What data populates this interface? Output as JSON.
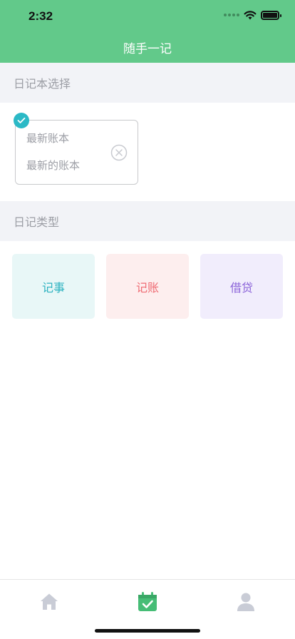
{
  "status": {
    "time": "2:32"
  },
  "nav": {
    "title": "随手一记"
  },
  "notebook_section": {
    "title": "日记本选择",
    "selected_notebook": {
      "name": "最新账本",
      "description": "最新的账本"
    }
  },
  "type_section": {
    "title": "日记类型",
    "types": [
      {
        "label": "记事",
        "bg": "#e8f7f7",
        "color": "#2bb2c0"
      },
      {
        "label": "记账",
        "bg": "#fdeeee",
        "color": "#ef6b73"
      },
      {
        "label": "借贷",
        "bg": "#f1edfc",
        "color": "#8b63d9"
      }
    ]
  },
  "tabbar": {
    "items": [
      {
        "icon": "home-icon",
        "active": false
      },
      {
        "icon": "calendar-check-icon",
        "active": true
      },
      {
        "icon": "user-icon",
        "active": false
      }
    ]
  },
  "colors": {
    "brand": "#62c98a",
    "accent": "#2bb9c6",
    "inactive_icon": "#c9ccd6"
  }
}
